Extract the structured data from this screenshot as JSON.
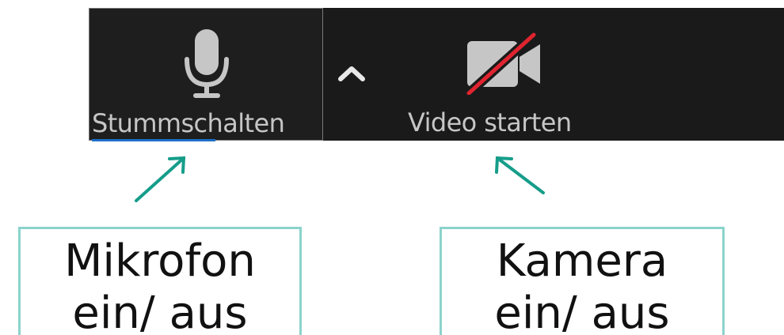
{
  "toolbar": {
    "mute_button": {
      "label": "Stummschalten",
      "icon": "microphone-icon"
    },
    "options_chevron": {
      "icon": "chevron-up-icon"
    },
    "video_button": {
      "label": "Video starten",
      "icon": "video-camera-off-icon"
    }
  },
  "callouts": {
    "microphone": {
      "line1": "Mikrofon",
      "line2": "ein/ aus"
    },
    "camera": {
      "line1": "Kamera",
      "line2": "ein/ aus"
    }
  },
  "colors": {
    "toolbar_background": "#1a1a1a",
    "icon_gray": "#c6c6c6",
    "camera_off_slash": "#e0242f",
    "focus_underline": "#1d6fc9",
    "callout_border": "#8bd3cc",
    "arrow": "#159d8a"
  }
}
